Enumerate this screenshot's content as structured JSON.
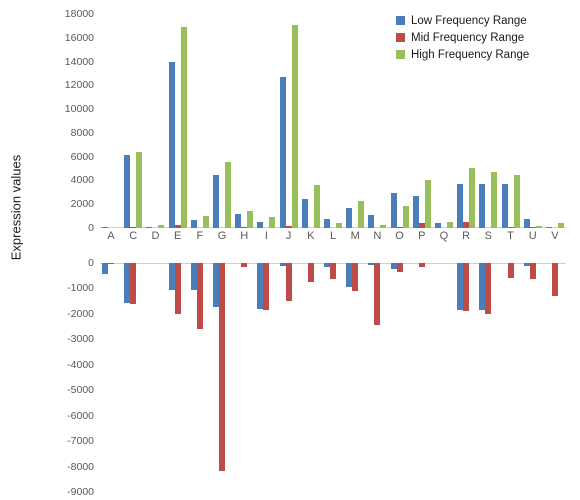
{
  "chart_data": {
    "type": "bar",
    "title": "",
    "xlabel": "",
    "ylabel": "Expression values",
    "grid": false,
    "legend_position": "top-right",
    "axis_note": "broken y-axis: upper panel 0 to 18000, lower panel 0 to -9000",
    "ylim_top": [
      0,
      18000
    ],
    "ylim_bottom": [
      -9000,
      0
    ],
    "ytick_labels_top": [
      "18000",
      "16000",
      "14000",
      "12000",
      "10000",
      "8000",
      "6000",
      "4000",
      "2000",
      "0"
    ],
    "ytick_values_top": [
      18000,
      16000,
      14000,
      12000,
      10000,
      8000,
      6000,
      4000,
      2000,
      0
    ],
    "ytick_labels_bottom": [
      "0",
      "-1000",
      "-2000",
      "-3000",
      "-4000",
      "-5000",
      "-6000",
      "-7000",
      "-8000",
      "-9000"
    ],
    "ytick_values_bottom": [
      0,
      -1000,
      -2000,
      -3000,
      -4000,
      -5000,
      -6000,
      -7000,
      -8000,
      -9000
    ],
    "categories": [
      "A",
      "C",
      "D",
      "E",
      "F",
      "G",
      "H",
      "I",
      "J",
      "K",
      "L",
      "M",
      "N",
      "O",
      "P",
      "Q",
      "R",
      "S",
      "T",
      "U",
      "V"
    ],
    "series": [
      {
        "name": "Low Frequency Range",
        "color": "#4a7ebb",
        "positive": [
          50,
          6100,
          80,
          13950,
          650,
          4420,
          1180,
          520,
          12680,
          2470,
          780,
          1700,
          1080,
          2920,
          2700,
          380,
          3720,
          3700,
          3680,
          740,
          110
        ],
        "negative": [
          -420,
          -1560,
          0,
          -1080,
          -1050,
          -1720,
          0,
          -1820,
          -100,
          0,
          -160,
          -960,
          -60,
          -240,
          0,
          0,
          -1840,
          -1840,
          0,
          -100,
          0
        ]
      },
      {
        "name": "Mid Frequency Range",
        "color": "#be4b48",
        "positive": [
          0,
          110,
          0,
          250,
          0,
          0,
          60,
          0,
          200,
          0,
          0,
          0,
          0,
          110,
          420,
          0,
          530,
          0,
          70,
          80,
          0
        ],
        "negative": [
          -20,
          -1620,
          0,
          -2020,
          -2600,
          -8180,
          -140,
          -1860,
          -1500,
          -760,
          -620,
          -1120,
          -2420,
          -340,
          -150,
          0,
          -1900,
          -2020,
          -600,
          -620,
          -1280
        ]
      },
      {
        "name": "High Frequency Range",
        "color": "#98bf5a",
        "positive": [
          0,
          6400,
          250,
          16900,
          1020,
          5550,
          1460,
          900,
          17050,
          3620,
          430,
          2250,
          240,
          1880,
          4000,
          480,
          5060,
          4720,
          4460,
          160,
          400
        ]
      }
    ]
  },
  "legend": {
    "items": [
      {
        "label": "Low Frequency Range",
        "color": "#4a7ebb"
      },
      {
        "label": "Mid Frequency Range",
        "color": "#be4b48"
      },
      {
        "label": "High Frequency Range",
        "color": "#98bf5a"
      }
    ]
  }
}
